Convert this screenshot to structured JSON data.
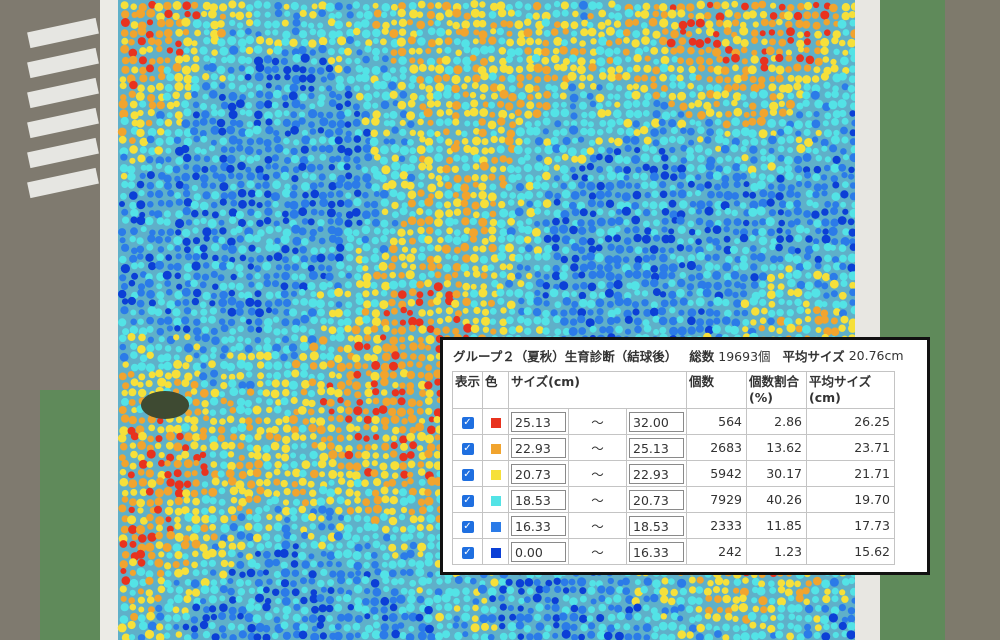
{
  "colors": {
    "deep_blue": "#0b3fd6",
    "blue": "#2b7be8",
    "cyan": "#53e3e6",
    "yellow": "#f6e03a",
    "orange": "#f1a42e",
    "red": "#e8321e",
    "field_background": "#5fb0c9",
    "road": "#7f7a6f",
    "grass": "#5f8a5a"
  },
  "panel": {
    "group_label": "グループ２（夏秋）生育診断（結球後）",
    "total_label": "総数",
    "total_value": "19693個",
    "avg_label": "平均サイズ",
    "avg_value": "20.76cm"
  },
  "table": {
    "headers": {
      "show": "表示",
      "color": "色",
      "size": "サイズ(cm)",
      "count": "個数",
      "ratio": "個数割合(%)",
      "avg": "平均サイズ(cm)"
    },
    "rows": [
      {
        "checked": true,
        "color": "#e8321e",
        "color_name": "red",
        "min": "25.13",
        "tilde": "〜",
        "max": "32.00",
        "count": "564",
        "ratio": "2.86",
        "avg": "26.25"
      },
      {
        "checked": true,
        "color": "#f1a42e",
        "color_name": "orange",
        "min": "22.93",
        "tilde": "〜",
        "max": "25.13",
        "count": "2683",
        "ratio": "13.62",
        "avg": "23.71"
      },
      {
        "checked": true,
        "color": "#f6e03a",
        "color_name": "yellow",
        "min": "20.73",
        "tilde": "〜",
        "max": "22.93",
        "count": "5942",
        "ratio": "30.17",
        "avg": "21.71"
      },
      {
        "checked": true,
        "color": "#53e3e6",
        "color_name": "cyan",
        "min": "18.53",
        "tilde": "〜",
        "max": "20.73",
        "count": "7929",
        "ratio": "40.26",
        "avg": "19.70"
      },
      {
        "checked": true,
        "color": "#2b7be8",
        "color_name": "blue",
        "min": "16.33",
        "tilde": "〜",
        "max": "18.53",
        "count": "2333",
        "ratio": "11.85",
        "avg": "17.73"
      },
      {
        "checked": true,
        "color": "#0b3fd6",
        "color_name": "deep-blue",
        "min": "0.00",
        "tilde": "〜",
        "max": "16.33",
        "count": "242",
        "ratio": "1.23",
        "avg": "15.62"
      }
    ]
  }
}
